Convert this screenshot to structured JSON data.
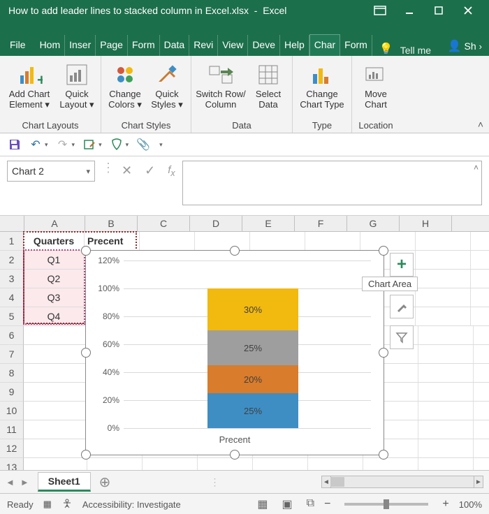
{
  "titlebar": {
    "filename": "How to add leader lines to stacked column in Excel.xlsx",
    "separator": "-",
    "app": "Excel"
  },
  "tabs": {
    "file": "File",
    "items": [
      "Hom",
      "Inser",
      "Page",
      "Form",
      "Data",
      "Revi",
      "View",
      "Deve",
      "Help"
    ],
    "context": [
      "Char",
      "Form"
    ],
    "active_context_index": 0,
    "tellme": "Tell me",
    "share": "Sh"
  },
  "ribbon": {
    "groups": [
      {
        "label": "Chart Layouts",
        "buttons": [
          {
            "name": "add-chart-element",
            "line1": "Add Chart",
            "line2": "Element ▾"
          },
          {
            "name": "quick-layout",
            "line1": "Quick",
            "line2": "Layout ▾"
          }
        ]
      },
      {
        "label": "Chart Styles",
        "buttons": [
          {
            "name": "change-colors",
            "line1": "Change",
            "line2": "Colors ▾"
          },
          {
            "name": "quick-styles",
            "line1": "Quick",
            "line2": "Styles ▾"
          }
        ]
      },
      {
        "label": "Data",
        "buttons": [
          {
            "name": "switch-row-column",
            "line1": "Switch Row/",
            "line2": "Column"
          },
          {
            "name": "select-data",
            "line1": "Select",
            "line2": "Data"
          }
        ]
      },
      {
        "label": "Type",
        "buttons": [
          {
            "name": "change-chart-type",
            "line1": "Change",
            "line2": "Chart Type"
          }
        ]
      },
      {
        "label": "Location",
        "buttons": [
          {
            "name": "move-chart",
            "line1": "Move",
            "line2": "Chart"
          }
        ]
      }
    ]
  },
  "namebox_value": "Chart 2",
  "columns": [
    "A",
    "B",
    "C",
    "D",
    "E",
    "F",
    "G",
    "H"
  ],
  "row_count": 13,
  "cells": {
    "A1": "Quarters",
    "B1": "Precent",
    "A2": "Q1",
    "A3": "Q2",
    "A4": "Q3",
    "A5": "Q4"
  },
  "sheet_tab": "Sheet1",
  "status": {
    "ready": "Ready",
    "accessibility": "Accessibility: Investigate",
    "zoom": "100%"
  },
  "chart_tooltip": "Chart Area",
  "chart_data": {
    "type": "stacked_bar",
    "categories": [
      ""
    ],
    "series": [
      {
        "name": "Q1",
        "values": [
          25
        ],
        "color": "#3e8ec4",
        "label": "25%"
      },
      {
        "name": "Q2",
        "values": [
          20
        ],
        "color": "#d97c2b",
        "label": "20%"
      },
      {
        "name": "Q3",
        "values": [
          25
        ],
        "color": "#9e9e9e",
        "label": "25%"
      },
      {
        "name": "Q4",
        "values": [
          30
        ],
        "color": "#f2b90f",
        "label": "30%"
      }
    ],
    "ylim": [
      0,
      120
    ],
    "yticks": [
      0,
      20,
      40,
      60,
      80,
      100,
      120
    ],
    "ytick_format_suffix": "%",
    "xlabel": "Precent",
    "title": "",
    "ylabel": ""
  }
}
